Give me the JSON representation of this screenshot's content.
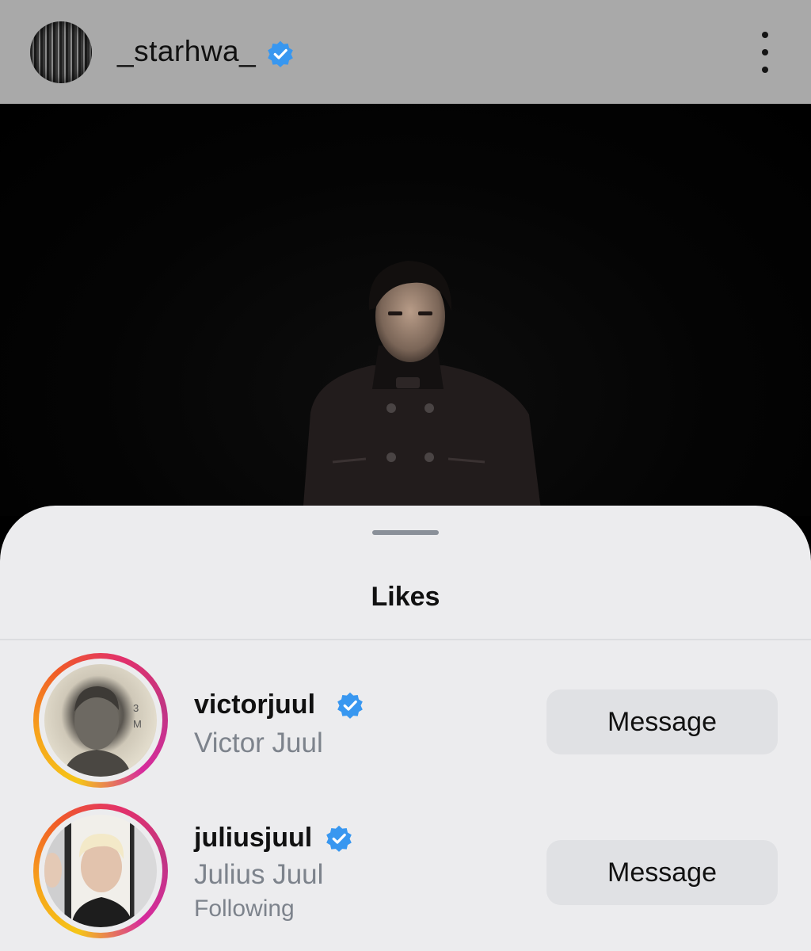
{
  "header": {
    "username": "_starhwa_",
    "verified_icon": "verified-badge-icon",
    "more_icon": "more-vertical-icon"
  },
  "sheet": {
    "title": "Likes",
    "likes": [
      {
        "username": "victorjuul",
        "full_name": "Victor Juul",
        "status": "",
        "button_label": "Message",
        "verified": true
      },
      {
        "username": "juliusjuul",
        "full_name": "Julius Juul",
        "status": "Following",
        "button_label": "Message",
        "verified": true
      }
    ]
  },
  "colors": {
    "verified_blue": "#3897f0",
    "header_bg": "#a9a9a9",
    "sheet_bg": "#ececee",
    "button_bg": "#e0e1e4",
    "secondary_text": "#7d838c"
  }
}
